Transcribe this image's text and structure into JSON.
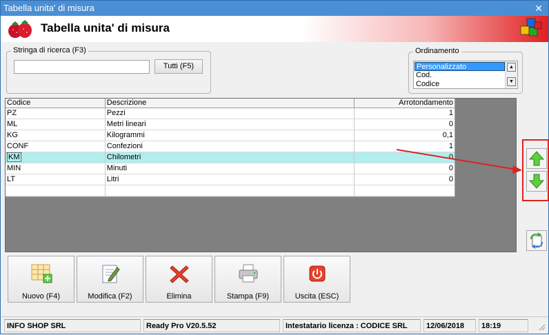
{
  "window": {
    "title": "Tabella unita' di misura",
    "close_glyph": "✕"
  },
  "header": {
    "title": "Tabella unita' di misura"
  },
  "search": {
    "legend": "Stringa di ricerca (F3)",
    "value": "",
    "tutti_label": "Tutti (F5)"
  },
  "ordering": {
    "legend": "Ordinamento",
    "options": [
      "Personalizzato",
      "Cod.",
      "Codice"
    ],
    "selected": "Personalizzato"
  },
  "table": {
    "columns": [
      "Codice",
      "Descrizione",
      "Arrotondamento"
    ],
    "rows": [
      {
        "codice": "PZ",
        "descrizione": "Pezzi",
        "arrotondamento": "1"
      },
      {
        "codice": "ML",
        "descrizione": "Metri lineari",
        "arrotondamento": "0"
      },
      {
        "codice": "KG",
        "descrizione": "Kilogrammi",
        "arrotondamento": "0,1"
      },
      {
        "codice": "CONF",
        "descrizione": "Confezioni",
        "arrotondamento": "1"
      },
      {
        "codice": "KM",
        "descrizione": "Chilometri",
        "arrotondamento": "0"
      },
      {
        "codice": "MIN",
        "descrizione": "Minuti",
        "arrotondamento": "0"
      },
      {
        "codice": "LT",
        "descrizione": "Litri",
        "arrotondamento": "0"
      },
      {
        "codice": "",
        "descrizione": "",
        "arrotondamento": ""
      }
    ],
    "selected_row": 4
  },
  "side_buttons": {
    "up_icon": "arrow-up-icon",
    "down_icon": "arrow-down-icon",
    "refresh_icon": "refresh-icon"
  },
  "buttons": {
    "nuovo": "Nuovo (F4)",
    "modifica": "Modifica (F2)",
    "elimina": "Elimina",
    "stampa": "Stampa (F9)",
    "uscita": "Uscita (ESC)"
  },
  "status": {
    "company": "INFO SHOP SRL",
    "version": "Ready Pro V20.5.52",
    "license": "Intestatario licenza : CODICE SRL",
    "date": "12/06/2018",
    "time": "18:19"
  },
  "colors": {
    "accent_red": "#e02020",
    "selection_row": "#b2eeee",
    "titlebar": "#4a8fd4",
    "list_selection": "#3399ff"
  }
}
